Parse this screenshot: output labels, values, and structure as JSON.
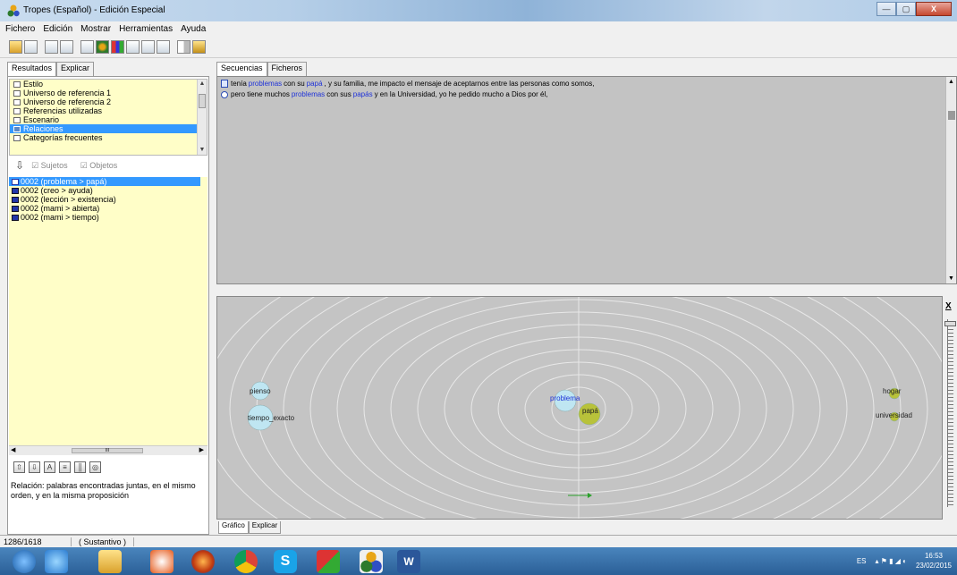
{
  "window": {
    "title": "Tropes (Español) - Edición Especial",
    "btn_min": "—",
    "btn_max": "▢",
    "btn_close": "X"
  },
  "menu": [
    "Fichero",
    "Edición",
    "Mostrar",
    "Herramientas",
    "Ayuda"
  ],
  "left": {
    "tabs": [
      "Resultados",
      "Explicar"
    ],
    "categories": [
      {
        "label": "Estilo",
        "selected": false
      },
      {
        "label": "Universo de referencia 1",
        "selected": false
      },
      {
        "label": "Universo de referencia 2",
        "selected": false
      },
      {
        "label": "Referencias utilizadas",
        "selected": false
      },
      {
        "label": "Escenario",
        "selected": false
      },
      {
        "label": "Relaciones",
        "selected": true
      },
      {
        "label": "Categorías frecuentes",
        "selected": false
      }
    ],
    "filters": {
      "subjects": "Sujetos",
      "objects": "Objetos",
      "check": "☑"
    },
    "relations": [
      {
        "label": "0002 (problema > papá)",
        "selected": true
      },
      {
        "label": "0002 (creo > ayuda)",
        "selected": false
      },
      {
        "label": "0002 (lección > existencia)",
        "selected": false
      },
      {
        "label": "0002 (mami > abierta)",
        "selected": false
      },
      {
        "label": "0002 (mami > tiempo)",
        "selected": false
      }
    ],
    "hscroll_thumb": "III",
    "description": "Relación: palabras encontradas juntas, en el mismo orden, y en la misma proposición"
  },
  "right": {
    "seq_tabs": [
      "Secuencias",
      "Ficheros"
    ],
    "sequences": [
      {
        "parts": [
          "tenía",
          "problemas",
          "con su",
          "papá",
          ", y su familia, me impacto el mensaje de aceptarnos entre las personas como somos,"
        ]
      },
      {
        "parts": [
          "pero tiene muchos",
          "problemas",
          "con sus",
          "papás",
          "y en la Universidad, yo he pedido mucho a Dios por él,"
        ]
      }
    ],
    "graph_tabs": [
      "Gráfico",
      "Explicar"
    ],
    "graph_close": "X",
    "graph_nodes": [
      {
        "label": "pienso",
        "color": "#bfe6f2"
      },
      {
        "label": "tiempo_exacto",
        "color": "#bfe6f2"
      },
      {
        "label": "problema",
        "color": "#bfe6f2",
        "highlight": true
      },
      {
        "label": "papá",
        "color": "#b8c23a"
      },
      {
        "label": "hogar",
        "color": "#b8c23a"
      },
      {
        "label": "universidad",
        "color": "#b8c23a"
      }
    ]
  },
  "status": {
    "count": "1286/1618",
    "type": "( Sustantivo )"
  },
  "tray": {
    "lang": "ES",
    "time": "16:53",
    "date": "23/02/2015"
  },
  "colors": {
    "selection": "#3399ff",
    "highlight_text": "#1f33d8",
    "list_bg": "#fffec8",
    "graph_bg": "#c4c4c4"
  }
}
